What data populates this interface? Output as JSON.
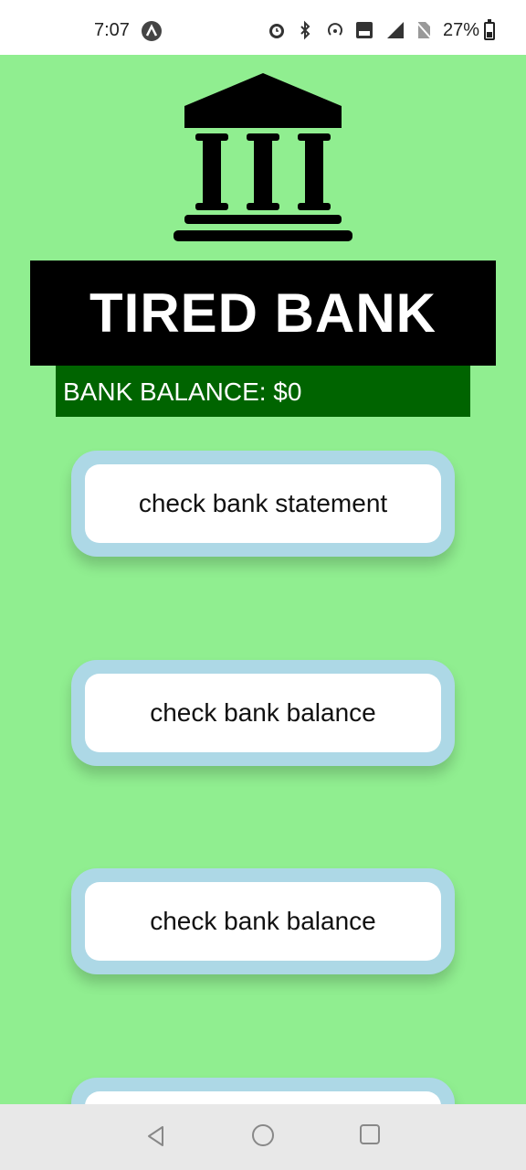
{
  "status_bar": {
    "time": "7:07",
    "battery_percent": "27%",
    "icons": [
      "alarm-icon",
      "bluetooth-icon",
      "hotspot-icon",
      "volte-icon",
      "4g-signal-icon",
      "no-sim-icon",
      "battery-icon"
    ]
  },
  "app": {
    "title": "TIRED BANK",
    "balance_text": "BANK BALANCE: $0",
    "buttons": [
      {
        "label": "check bank statement"
      },
      {
        "label": "check bank balance"
      },
      {
        "label": "check bank balance"
      }
    ],
    "colors": {
      "background": "#90ee90",
      "title_bg": "#000000",
      "balance_bg": "#006400",
      "button_outer": "#add8e6",
      "button_inner": "#ffffff"
    }
  },
  "nav_bar": {
    "icons": [
      "back-icon",
      "home-icon",
      "recents-icon"
    ]
  }
}
